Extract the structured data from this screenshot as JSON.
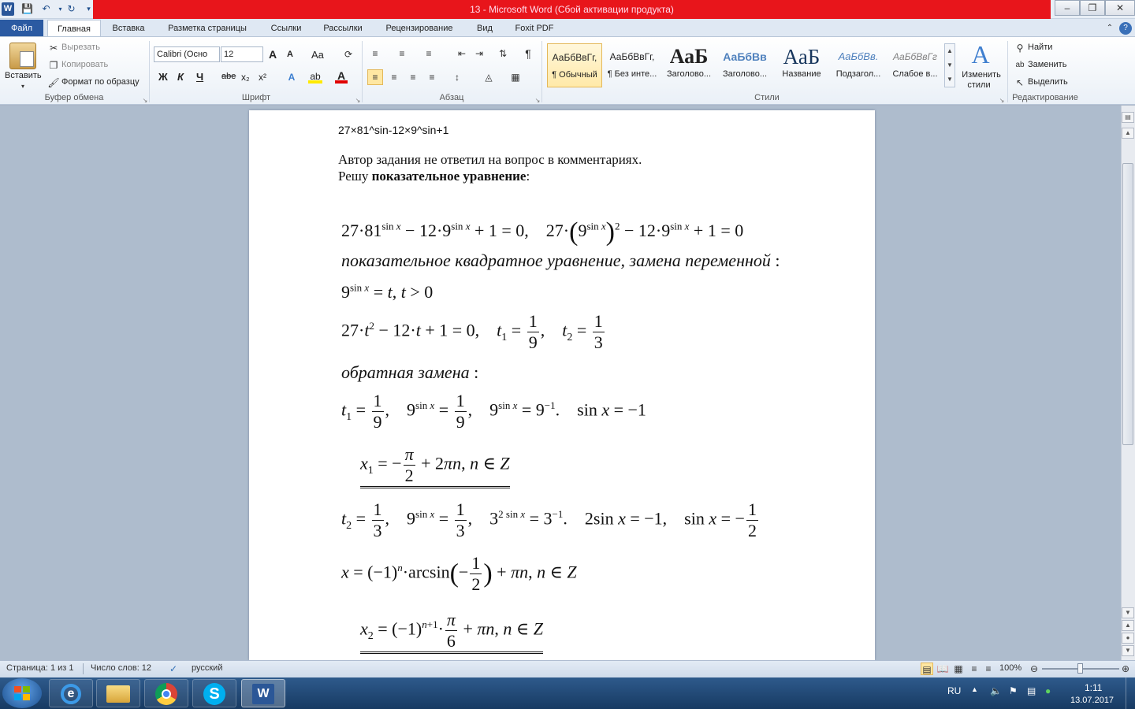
{
  "window": {
    "title": "13 - Microsoft Word (Сбой активации продукта)",
    "app_logo": "W"
  },
  "tabs": [
    "Файл",
    "Главная",
    "Вставка",
    "Разметка страницы",
    "Ссылки",
    "Рассылки",
    "Рецензирование",
    "Вид",
    "Foxit PDF"
  ],
  "ribbon": {
    "clipboard": {
      "paste": "Вставить",
      "cut": "Вырезать",
      "copy": "Копировать",
      "format_painter": "Формат по образцу",
      "group": "Буфер обмена"
    },
    "font": {
      "name": "Calibri (Осно",
      "size": "12",
      "group": "Шрифт",
      "bold": "Ж",
      "italic": "К",
      "underline": "Ч",
      "strike": "abe",
      "sub": "x₂",
      "sup": "x²",
      "grow": "A",
      "shrink": "A",
      "case": "Aa"
    },
    "paragraph": {
      "group": "Абзац"
    },
    "styles": {
      "group": "Стили",
      "items": [
        {
          "preview": "АаБбВвГг,",
          "label": "¶ Обычный"
        },
        {
          "preview": "АаБбВвГг,",
          "label": "¶ Без инте..."
        },
        {
          "preview": "АаБ",
          "label": "Заголово..."
        },
        {
          "preview": "АаБбВв",
          "label": "Заголово..."
        },
        {
          "preview": "АаБ",
          "label": "Название"
        },
        {
          "preview": "АаБбВв.",
          "label": "Подзагол..."
        },
        {
          "preview": "АаБбВвГг",
          "label": "Слабое в..."
        }
      ],
      "change_line1": "Изменить",
      "change_line2": "стили"
    },
    "editing": {
      "find": "Найти",
      "replace": "Заменить",
      "select": "Выделить",
      "group": "Редактирование"
    }
  },
  "document": {
    "line1": "27×81^sin-12×9^sin+1",
    "line2": "Автор задания не ответил на вопрос в комментариях.",
    "line3_prefix": "Решу ",
    "line3_bold": "показательное уравнение",
    "line3_suffix": ":",
    "text_substitution": "показательное квадратное уравнение, замена переменной",
    "text_reverse": "обратная замена"
  },
  "status": {
    "page": "Страница: 1 из 1",
    "words": "Число слов: 12",
    "language": "русский",
    "zoom": "100%"
  },
  "taskbar": {
    "lang": "RU",
    "time": "1:11",
    "date": "13.07.2017"
  }
}
